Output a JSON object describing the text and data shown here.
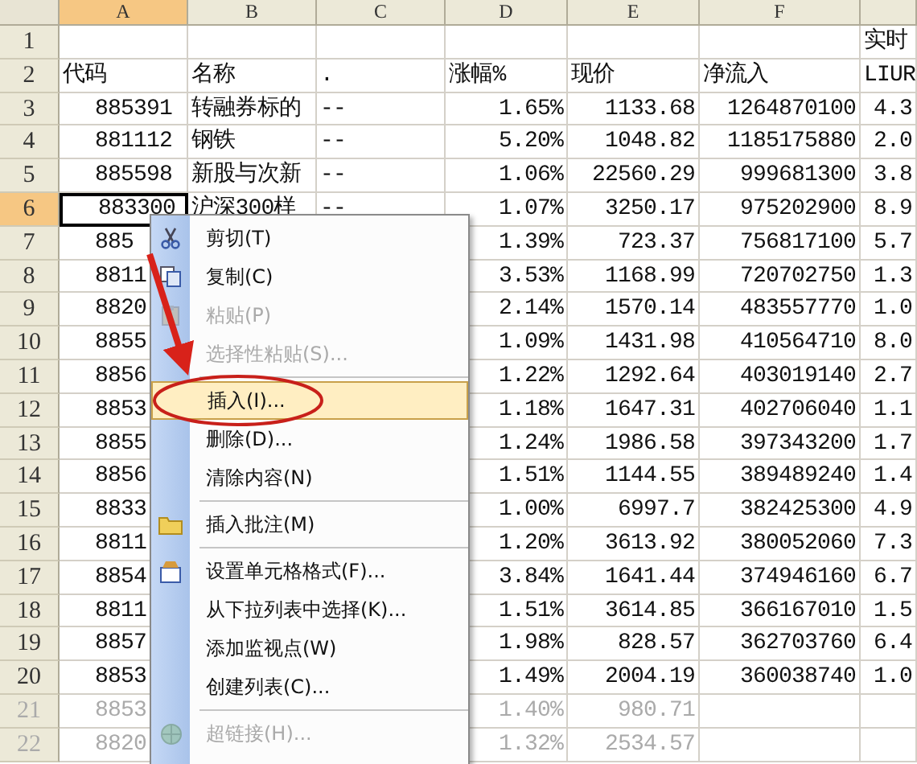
{
  "columns": [
    {
      "letter": "A",
      "selected": true
    },
    {
      "letter": "B",
      "selected": false
    },
    {
      "letter": "C",
      "selected": false
    },
    {
      "letter": "D",
      "selected": false
    },
    {
      "letter": "E",
      "selected": false
    },
    {
      "letter": "F",
      "selected": false
    },
    {
      "selected": false
    }
  ],
  "rows": [
    {
      "number": "1",
      "kind": "header",
      "selected": false,
      "faded": false,
      "cells": [
        null,
        null,
        null,
        null,
        null,
        null,
        "实时"
      ]
    },
    {
      "number": "2",
      "kind": "header",
      "selected": false,
      "faded": false,
      "cells": [
        "代码",
        "名称",
        ".",
        "涨幅%",
        "现价",
        "净流入",
        "LIUR"
      ]
    },
    {
      "number": "3",
      "kind": "data",
      "selected": false,
      "faded": false,
      "cells": [
        "885391",
        "转融券标的",
        "--",
        "1.65%",
        "1133.68",
        "1264870100",
        "4.3"
      ]
    },
    {
      "number": "4",
      "kind": "data",
      "selected": false,
      "faded": false,
      "cells": [
        "881112",
        "钢铁",
        "--",
        "5.20%",
        "1048.82",
        "1185175880",
        "2.0"
      ]
    },
    {
      "number": "5",
      "kind": "data",
      "selected": false,
      "faded": false,
      "cells": [
        "885598",
        "新股与次新",
        "--",
        "1.06%",
        "22560.29",
        "999681300",
        "3.8"
      ]
    },
    {
      "number": "6",
      "kind": "data",
      "selected": true,
      "faded": false,
      "cells": [
        "883300",
        "沪深300样",
        "--",
        "1.07%",
        "3250.17",
        "975202900",
        "8.9"
      ]
    },
    {
      "number": "7",
      "kind": "data",
      "selected": false,
      "faded": false,
      "cells": [
        "885",
        null,
        null,
        "1.39%",
        "723.37",
        "756817100",
        "5.7"
      ]
    },
    {
      "number": "8",
      "kind": "data",
      "selected": false,
      "faded": false,
      "cells": [
        "8811",
        null,
        null,
        "3.53%",
        "1168.99",
        "720702750",
        "1.3"
      ]
    },
    {
      "number": "9",
      "kind": "data",
      "selected": false,
      "faded": false,
      "cells": [
        "8820",
        null,
        null,
        "2.14%",
        "1570.14",
        "483557770",
        "1.0"
      ]
    },
    {
      "number": "10",
      "kind": "data",
      "selected": false,
      "faded": false,
      "cells": [
        "8855",
        null,
        null,
        "1.09%",
        "1431.98",
        "410564710",
        "8.0"
      ]
    },
    {
      "number": "11",
      "kind": "data",
      "selected": false,
      "faded": false,
      "cells": [
        "8856",
        null,
        null,
        "1.22%",
        "1292.64",
        "403019140",
        "2.7"
      ]
    },
    {
      "number": "12",
      "kind": "data",
      "selected": false,
      "faded": false,
      "cells": [
        "8853",
        null,
        null,
        "1.18%",
        "1647.31",
        "402706040",
        "1.1"
      ]
    },
    {
      "number": "13",
      "kind": "data",
      "selected": false,
      "faded": false,
      "cells": [
        "8855",
        null,
        null,
        "1.24%",
        "1986.58",
        "397343200",
        "1.7"
      ]
    },
    {
      "number": "14",
      "kind": "data",
      "selected": false,
      "faded": false,
      "cells": [
        "8856",
        null,
        null,
        "1.51%",
        "1144.55",
        "389489240",
        "1.4"
      ]
    },
    {
      "number": "15",
      "kind": "data",
      "selected": false,
      "faded": false,
      "cells": [
        "8833",
        null,
        null,
        "1.00%",
        "6997.7",
        "382425300",
        "4.9"
      ]
    },
    {
      "number": "16",
      "kind": "data",
      "selected": false,
      "faded": false,
      "cells": [
        "8811",
        null,
        null,
        "1.20%",
        "3613.92",
        "380052060",
        "7.3"
      ]
    },
    {
      "number": "17",
      "kind": "data",
      "selected": false,
      "faded": false,
      "cells": [
        "8854",
        null,
        null,
        "3.84%",
        "1641.44",
        "374946160",
        "6.7"
      ]
    },
    {
      "number": "18",
      "kind": "data",
      "selected": false,
      "faded": false,
      "cells": [
        "8811",
        null,
        null,
        "1.51%",
        "3614.85",
        "366167010",
        "1.5"
      ]
    },
    {
      "number": "19",
      "kind": "data",
      "selected": false,
      "faded": false,
      "cells": [
        "8857",
        null,
        null,
        "1.98%",
        "828.57",
        "362703760",
        "6.4"
      ]
    },
    {
      "number": "20",
      "kind": "data",
      "selected": false,
      "faded": false,
      "cells": [
        "8853",
        null,
        null,
        "1.49%",
        "2004.19",
        "360038740",
        "1.0"
      ]
    },
    {
      "number": "21",
      "kind": "data",
      "selected": false,
      "faded": true,
      "cells": [
        "8853",
        null,
        null,
        "1.40%",
        "980.71",
        null,
        null
      ]
    },
    {
      "number": "22",
      "kind": "data",
      "selected": false,
      "faded": true,
      "cells": [
        "8820",
        null,
        null,
        "1.32%",
        "2534.57",
        null,
        null
      ]
    }
  ],
  "context_menu": {
    "items": [
      {
        "kind": "item",
        "label": "剪切(T)",
        "disabled": false,
        "selected": false
      },
      {
        "kind": "item",
        "label": "复制(C)",
        "disabled": false,
        "selected": false
      },
      {
        "kind": "item",
        "label": "粘贴(P)",
        "disabled": true,
        "selected": false
      },
      {
        "kind": "item",
        "label": "选择性粘贴(S)...",
        "disabled": true,
        "selected": false
      },
      {
        "kind": "separator"
      },
      {
        "kind": "item",
        "label": "插入(I)...",
        "disabled": false,
        "selected": true
      },
      {
        "kind": "item",
        "label": "删除(D)...",
        "disabled": false,
        "selected": false
      },
      {
        "kind": "item",
        "label": "清除内容(N)",
        "disabled": false,
        "selected": false
      },
      {
        "kind": "separator"
      },
      {
        "kind": "item",
        "label": "插入批注(M)",
        "disabled": false,
        "selected": false
      },
      {
        "kind": "separator"
      },
      {
        "kind": "item",
        "label": "设置单元格格式(F)...",
        "disabled": false,
        "selected": false
      },
      {
        "kind": "item",
        "label": "从下拉列表中选择(K)...",
        "disabled": false,
        "selected": false
      },
      {
        "kind": "item",
        "label": "添加监视点(W)",
        "disabled": false,
        "selected": false
      },
      {
        "kind": "item",
        "label": "创建列表(C)...",
        "disabled": false,
        "selected": false
      },
      {
        "kind": "separator"
      },
      {
        "kind": "item",
        "label": "超链接(H)...",
        "disabled": true,
        "selected": false
      }
    ]
  }
}
